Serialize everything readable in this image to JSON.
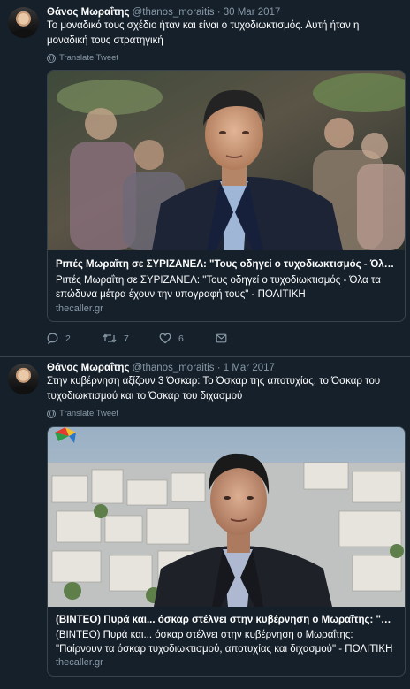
{
  "tweets": [
    {
      "author_name": "Θάνος Μωραΐτης",
      "handle": "@thanos_moraitis",
      "separator": "·",
      "date": "30 Mar 2017",
      "text": "Το μοναδικό τους σχέδιο ήταν και είναι ο τυχοδιωκτισμός. Αυτή ήταν η μοναδική τους στρατηγική",
      "translate_label": "Translate Tweet",
      "card": {
        "title": "Ριπές Μωραΐτη σε ΣΥΡΙΖΑΝΕΛ: \"Τους οδηγεί ο τυχοδιωκτισμός - Όλα τα επώδυνα μέτρα έχουν την υπογραφή τους\" - ΠΟΛΙΤΙΚΗ",
        "description": "Ριπές Μωραΐτη σε ΣΥΡΙΖΑΝΕΛ: \"Τους οδηγεί ο τυχοδιωκτισμός - Όλα τα επώδυνα μέτρα έχουν την υπογραφή τους\" - ΠΟΛΙΤΙΚΗ",
        "domain": "thecaller.gr"
      },
      "actions": {
        "reply_icon": "reply-icon",
        "replies": "2",
        "retweet_icon": "retweet-icon",
        "retweets": "7",
        "like_icon": "heart-icon",
        "likes": "6",
        "share_icon": "share-icon"
      }
    },
    {
      "author_name": "Θάνος Μωραΐτης",
      "handle": "@thanos_moraitis",
      "separator": "·",
      "date": "1 Mar 2017",
      "text": "Στην κυβέρνηση  αξίζουν 3 Όσκαρ: Το Όσκαρ της αποτυχίας, το Όσκαρ του τυχοδιωκτισμού και το Όσκαρ του διχασμού",
      "translate_label": "Translate Tweet",
      "card": {
        "title": "(ΒΙΝΤΕΟ) Πυρά και... όσκαρ στέλνει στην κυβέρνηση ο Μωραΐτης: \"Παίρνουν τα όσκαρ τυχοδιωκτισμού, αποτυχίας και διχασμού\" - ΠΟΛΙΤΙΚΗ",
        "description": "(ΒΙΝΤΕΟ) Πυρά και... όσκαρ στέλνει στην κυβέρνηση ο Μωραΐτης: \"Παίρνουν τα όσκαρ τυχοδιωκτισμού, αποτυχίας και διχασμού\" - ΠΟΛΙΤΙΚΗ",
        "domain": "thecaller.gr"
      }
    }
  ],
  "colors": {
    "background": "#15202b",
    "secondary_text": "#8899a6",
    "border": "#38444d"
  }
}
